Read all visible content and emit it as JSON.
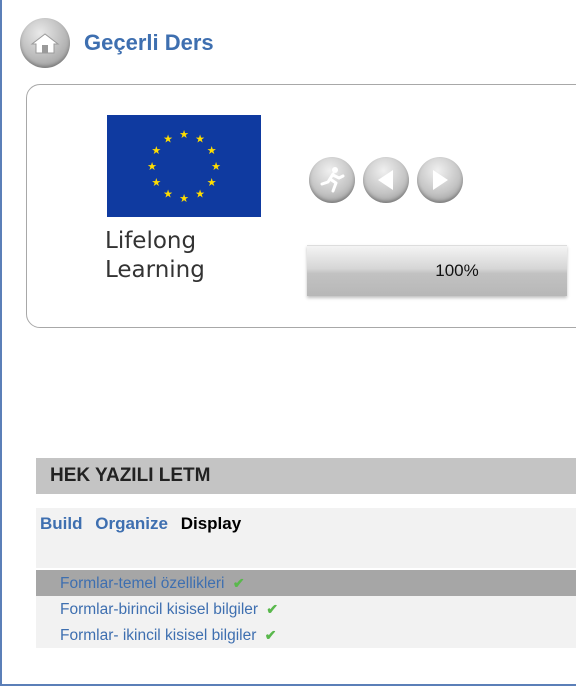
{
  "header": {
    "title": "Geçerli Ders",
    "home_icon": "home-icon"
  },
  "course_card": {
    "logo_text_line1": "Lifelong",
    "logo_text_line2": "Learning",
    "nav_icons": [
      "runner-icon",
      "prev-arrow-icon",
      "next-arrow-icon"
    ],
    "progress": {
      "label": "100%",
      "value": 1.0
    }
  },
  "module": {
    "title": "HEK YAZILI LETM",
    "tabs": [
      {
        "label": "Build",
        "active": false
      },
      {
        "label": "Organize",
        "active": false
      },
      {
        "label": "Display",
        "active": true
      }
    ],
    "lessons": [
      {
        "label": "Formlar-temel özellikleri",
        "selected": true,
        "completed": true
      },
      {
        "label": "Formlar-birincil kisisel bilgiler",
        "selected": false,
        "completed": true
      },
      {
        "label": "Formlar- ikincil kisisel bilgiler",
        "selected": false,
        "completed": true
      }
    ]
  },
  "colors": {
    "link": "#3e6fb0",
    "eu_blue": "#0f3aa0",
    "eu_star": "#ffdd00",
    "check": "#59b84c",
    "selected_row": "#a6a6a6"
  }
}
